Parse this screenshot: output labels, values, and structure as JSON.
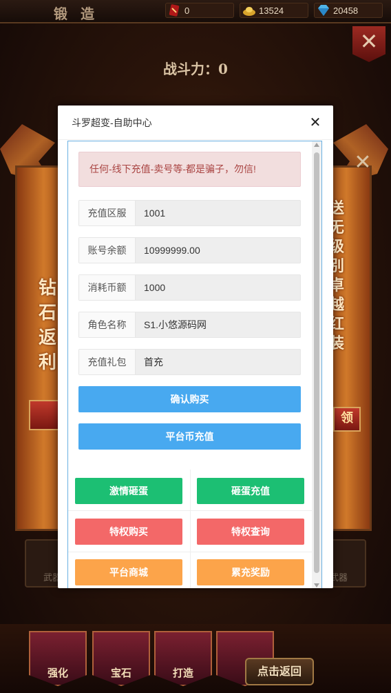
{
  "game": {
    "forge_title": "锻 造",
    "resources": {
      "card_count": "0",
      "gold": "13524",
      "diamond": "20458"
    },
    "power_label": "战斗力：0",
    "side_left_text": "钻石返利",
    "side_right_text": "送无级别卓越红装",
    "ribbon_right": "领",
    "lock_left_label": "武器",
    "lock_right_label": "武器",
    "nav": [
      "强化",
      "宝石",
      "打造"
    ],
    "back_label": "点击返回",
    "colors": {
      "accent": "#d0792a",
      "frame": "#5a3a20"
    }
  },
  "modal": {
    "title": "斗罗超变-自助中心",
    "close_icon": "close-icon",
    "alert": "任何-线下充值-卖号等-都是骗子，勿信!",
    "fields": [
      {
        "label": "充值区服",
        "value": "1001"
      },
      {
        "label": "账号余额",
        "value": "10999999.00"
      },
      {
        "label": "消耗币额",
        "value": "1000"
      },
      {
        "label": "角色名称",
        "value": "S1.小悠源码网"
      },
      {
        "label": "充值礼包",
        "value": "首充"
      }
    ],
    "confirm_button": "确认购买",
    "platform_recharge_button": "平台币充值",
    "grid_buttons": [
      {
        "label": "激情砸蛋",
        "color": "#1cbf73"
      },
      {
        "label": "砸蛋充值",
        "color": "#1cbf73"
      },
      {
        "label": "特权购买",
        "color": "#f36868"
      },
      {
        "label": "特权查询",
        "color": "#f36868"
      },
      {
        "label": "平台商城",
        "color": "#fca44a"
      },
      {
        "label": "累充奖励",
        "color": "#fca44a"
      }
    ],
    "colors": {
      "primary": "#48a9f0",
      "alert_bg": "#f2dede",
      "alert_text": "#a94442"
    }
  }
}
